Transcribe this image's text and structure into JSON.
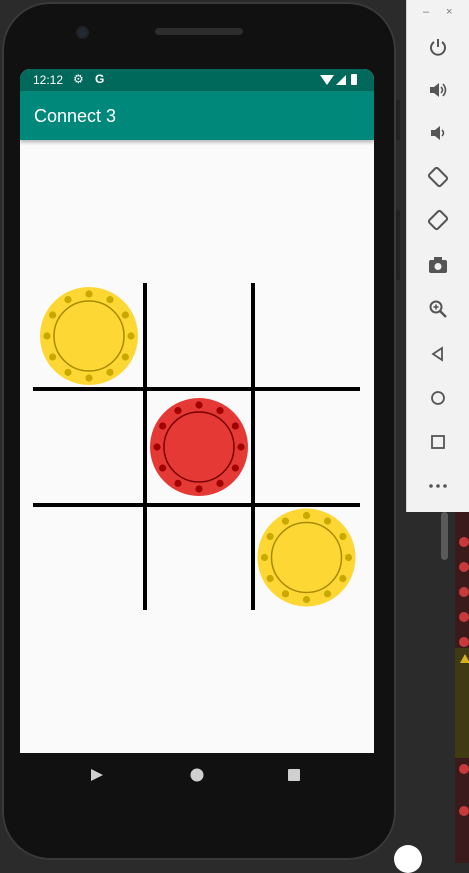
{
  "status_bar": {
    "time": "12:12",
    "settings_icon": "gear-icon",
    "g_badge": "G",
    "wifi_icon": "wifi-icon",
    "signal_icon": "signal-icon",
    "battery_icon": "battery-icon"
  },
  "app_bar": {
    "title": "Connect 3"
  },
  "board": {
    "rows": 3,
    "cols": 3,
    "cells": [
      [
        "yellow",
        null,
        null
      ],
      [
        null,
        "red",
        null
      ],
      [
        null,
        null,
        "yellow"
      ]
    ],
    "colors": {
      "yellow": "#fdd835",
      "red": "#e53935",
      "grid": "#000000"
    }
  },
  "nav_bar": {
    "back": "back-icon",
    "home": "home-icon",
    "recents": "recents-icon"
  },
  "emulator_panel": {
    "window_controls": [
      "–",
      "×"
    ],
    "buttons": [
      "power-icon",
      "volume-up-icon",
      "volume-down-icon",
      "rotate-left-icon",
      "rotate-right-icon",
      "camera-icon",
      "zoom-icon",
      "back-icon",
      "home-icon",
      "overview-icon",
      "more-icon"
    ]
  },
  "colors": {
    "primary": "#00897b",
    "primary_dark": "#00695c"
  }
}
